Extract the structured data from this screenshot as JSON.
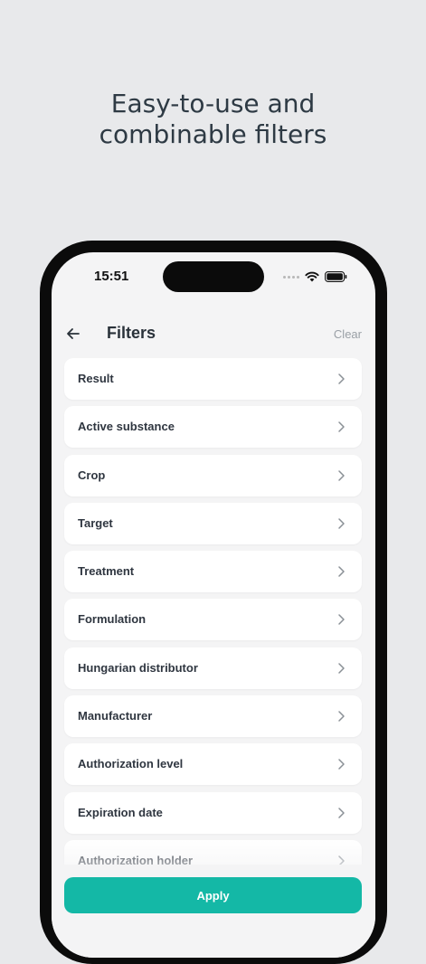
{
  "headline": {
    "line1": "Easy-to-use and",
    "line2": "combinable filters"
  },
  "status_bar": {
    "time": "15:51",
    "icons": [
      "signal-dots-icon",
      "wifi-icon",
      "battery-icon"
    ]
  },
  "nav": {
    "back_icon": "arrow-left-icon",
    "title": "Filters",
    "clear_label": "Clear"
  },
  "filters": [
    {
      "label": "Result"
    },
    {
      "label": "Active substance"
    },
    {
      "label": "Crop"
    },
    {
      "label": "Target"
    },
    {
      "label": "Treatment"
    },
    {
      "label": "Formulation"
    },
    {
      "label": "Hungarian distributor"
    },
    {
      "label": "Manufacturer"
    },
    {
      "label": "Authorization level"
    },
    {
      "label": "Expiration date"
    },
    {
      "label": "Authorization holder"
    }
  ],
  "apply_label": "Apply",
  "colors": {
    "background": "#e8e9eb",
    "accent": "#14b8a6",
    "text": "#2f3640",
    "muted": "#9aa0a6"
  }
}
